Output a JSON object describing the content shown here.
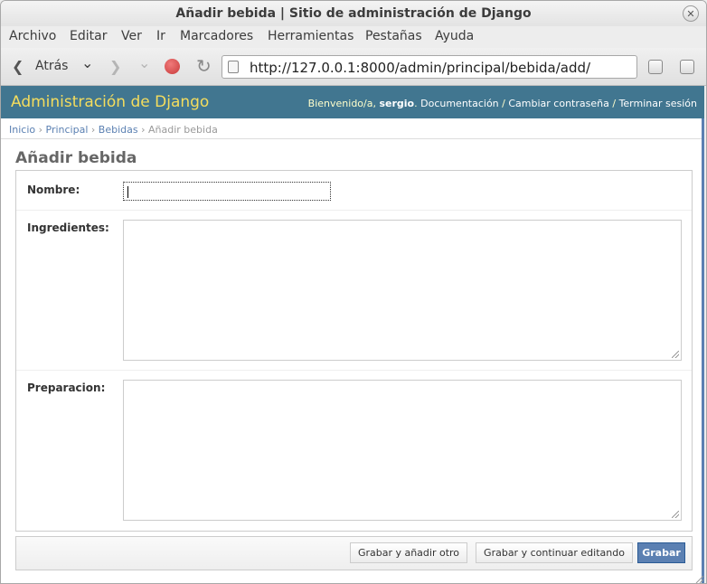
{
  "window": {
    "title": "Añadir bebida | Sitio de administración de Django",
    "close_glyph": "✕"
  },
  "menubar": {
    "items": [
      "Archivo",
      "Editar",
      "Ver",
      "Ir",
      "Marcadores",
      "Herramientas",
      "Pestañas",
      "Ayuda"
    ]
  },
  "toolbar": {
    "back_label": "Atrás",
    "back_glyph": "❮",
    "dropdown_glyph": "⌄",
    "forward_glyph": "❯",
    "reload_glyph": "↻",
    "url": "http://127.0.0.1:8000/admin/principal/bebida/add/"
  },
  "header": {
    "brand": "Administración de Django",
    "welcome": "Bienvenido/a, ",
    "username": "sergio",
    "sep_1": ". ",
    "docs_link": "Documentación",
    "sep_2": " / ",
    "password_link": "Cambiar contraseña",
    "sep_3": " / ",
    "logout_link": "Terminar sesión"
  },
  "breadcrumbs": {
    "home": "Inicio",
    "app": "Principal",
    "model": "Bebidas",
    "current": "Añadir bebida",
    "separator": " › "
  },
  "page": {
    "title": "Añadir bebida"
  },
  "form": {
    "nombre_label": "Nombre:",
    "nombre_value": "",
    "ingredientes_label": "Ingredientes:",
    "ingredientes_value": "",
    "preparacion_label": "Preparacion:",
    "preparacion_value": ""
  },
  "submit": {
    "save_add": "Grabar y añadir otro",
    "save_continue": "Grabar y continuar editando",
    "save": "Grabar"
  },
  "colors": {
    "header_bg": "#417690",
    "brand": "#f5dd5d",
    "link": "#5b80b2",
    "primary_button": "#5b80b2"
  }
}
